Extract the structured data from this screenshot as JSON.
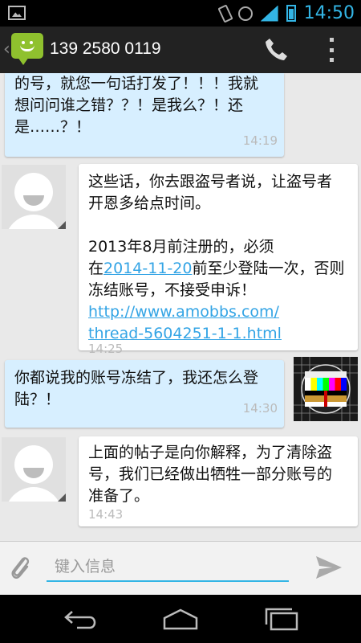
{
  "status_bar": {
    "time": "14:50"
  },
  "action_bar": {
    "contact": "139 2580 0119"
  },
  "messages": [
    {
      "dir": "out",
      "text": "的号，就您一句话打发了！！！我就\n想问问谁之错？？！是我么？！还\n是……？！",
      "time": "14:19"
    },
    {
      "dir": "in",
      "text1": "这些话，你去跟盗号者说，让盗号者\n开恩多给点时间。\n\n2013年8月前注册的，必须\n在",
      "date_link": "2014-11-20",
      "text2": "前至少登陆一次，否则\n冻结账号，不接受申诉！\n",
      "url": "http://www.amobbs.com/\nthread-5604251-1-1.html",
      "time": "14:25"
    },
    {
      "dir": "out",
      "text": "你都说我的账号冻结了，我还怎么登\n陆？！",
      "time": "14:30"
    },
    {
      "dir": "in",
      "text": "上面的帖子是向你解释，为了清除盗\n号，我们已经做出牺牲一部分账号的\n准备了。",
      "time": "14:43"
    }
  ],
  "compose": {
    "placeholder": "键入信息"
  },
  "colors": {
    "accent": "#33b5e5",
    "outgoing_bubble": "#d7efff",
    "incoming_bubble": "#ffffff",
    "app_green": "#8fc12e"
  },
  "icons": [
    "image-icon",
    "vibrate-icon",
    "alarm-icon",
    "signal-icon",
    "battery-icon",
    "messaging-app-icon",
    "phone-icon",
    "overflow-menu-icon",
    "attach-icon",
    "send-icon",
    "back-nav-icon",
    "home-nav-icon",
    "recents-nav-icon"
  ]
}
